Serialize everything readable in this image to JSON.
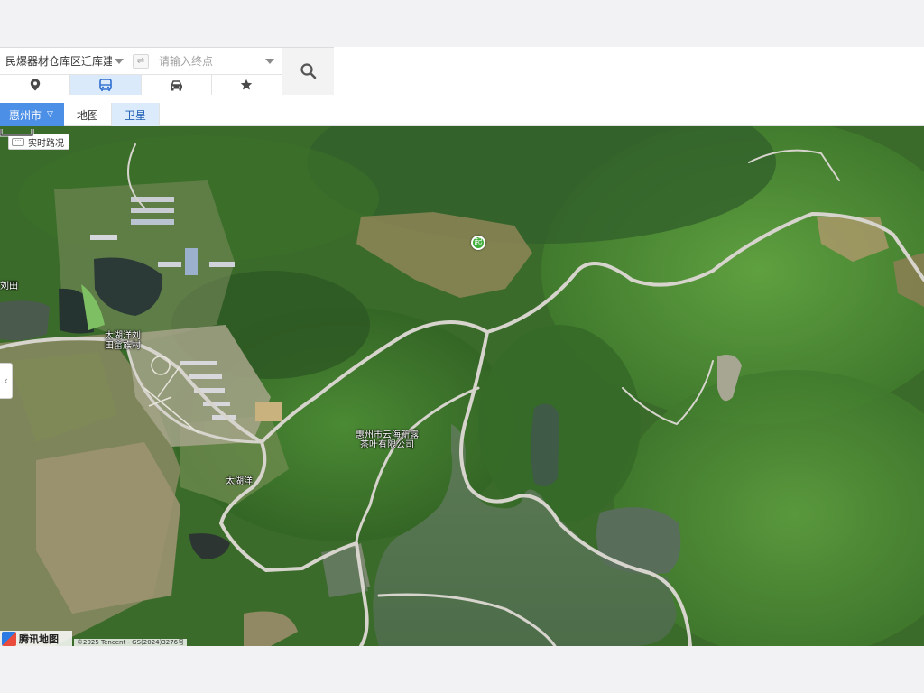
{
  "route": {
    "start_value": "民爆器材仓库区迁库建",
    "end_placeholder": "请输入终点",
    "swap_symbol": "⇌"
  },
  "modes": [
    {
      "name": "location",
      "icon": "location-pin-icon",
      "active": false
    },
    {
      "name": "bus",
      "icon": "bus-icon",
      "active": true
    },
    {
      "name": "car",
      "icon": "car-icon",
      "active": false
    },
    {
      "name": "favorite",
      "icon": "star-icon",
      "active": false
    }
  ],
  "tabs": {
    "city": "惠州市",
    "map": "地图",
    "satellite": "卫星",
    "active": "satellite"
  },
  "map": {
    "traffic_button": "实时路况",
    "labels": {
      "liutian": "刘田",
      "village_line1": "太湖洋刘",
      "village_line2": "田畲族村",
      "company_line1": "惠州市云海新露",
      "company_line2": "茶叶有限公司",
      "taihuyang": "太湖洋"
    },
    "start_marker": "起",
    "logo_text": "腾讯地图",
    "copyright": "©2025 Tencent - GS(2024)3276号"
  },
  "colors": {
    "accent": "#4c8fe6",
    "satellite_tab_bg": "#dcebfb",
    "start_marker": "#3fae3a"
  }
}
